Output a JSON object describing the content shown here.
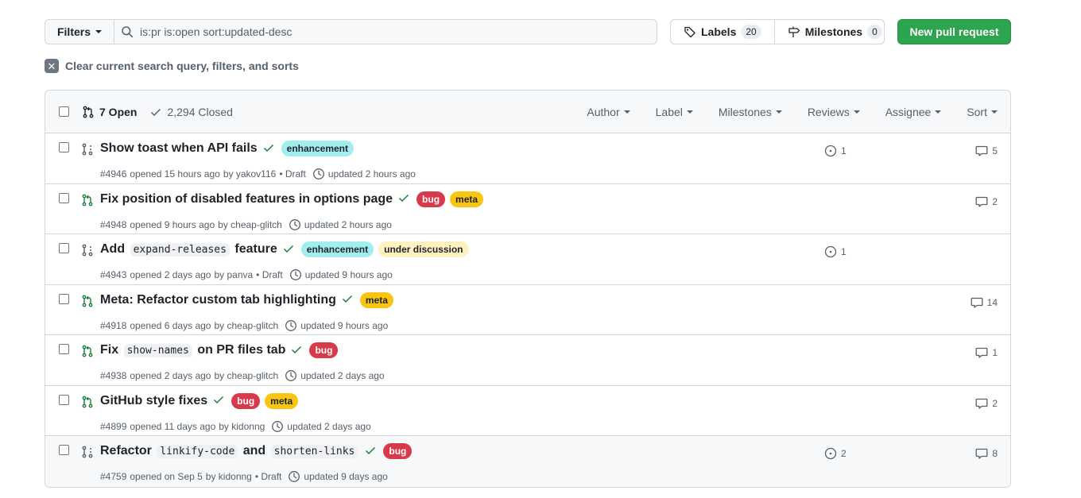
{
  "toolbar": {
    "filters_label": "Filters",
    "search_value": "is:pr is:open sort:updated-desc",
    "labels_label": "Labels",
    "labels_count": "20",
    "milestones_label": "Milestones",
    "milestones_count": "0",
    "new_pr_label": "New pull request"
  },
  "clear_query_label": "Clear current search query, filters, and sorts",
  "header": {
    "open_label": "7 Open",
    "closed_label": "2,294 Closed",
    "filters": [
      "Author",
      "Label",
      "Milestones",
      "Reviews",
      "Assignee",
      "Sort"
    ]
  },
  "colors": {
    "open_green": "#1a7f37",
    "draft_gray": "#57606a",
    "enhancement": "#a2eeef",
    "bug": "#d73a4a",
    "meta": "#f9c513",
    "under_discussion": "#fef2c0"
  },
  "pull_requests": [
    {
      "state": "draft",
      "title_parts": [
        {
          "t": "text",
          "v": "Show toast when API fails"
        }
      ],
      "labels": [
        {
          "name": "enhancement",
          "bg": "#a2eeef",
          "fg": "#1f2328"
        }
      ],
      "number": "#4946",
      "opened": "opened 15 hours ago",
      "author": "by yakov116",
      "draft": "• Draft",
      "updated": "updated 2 hours ago",
      "linked_issues": "1",
      "comments": "5"
    },
    {
      "state": "open",
      "title_parts": [
        {
          "t": "text",
          "v": "Fix position of disabled features in options page"
        }
      ],
      "labels": [
        {
          "name": "bug",
          "bg": "#d73a4a",
          "fg": "#ffffff"
        },
        {
          "name": "meta",
          "bg": "#f9c513",
          "fg": "#1f2328"
        }
      ],
      "number": "#4948",
      "opened": "opened 9 hours ago",
      "author": "by cheap-glitch",
      "draft": "",
      "updated": "updated 2 hours ago",
      "linked_issues": "",
      "comments": "2"
    },
    {
      "state": "draft",
      "title_parts": [
        {
          "t": "text",
          "v": "Add"
        },
        {
          "t": "code",
          "v": "expand-releases"
        },
        {
          "t": "text",
          "v": "feature"
        }
      ],
      "labels": [
        {
          "name": "enhancement",
          "bg": "#a2eeef",
          "fg": "#1f2328"
        },
        {
          "name": "under discussion",
          "bg": "#fef2c0",
          "fg": "#1f2328"
        }
      ],
      "number": "#4943",
      "opened": "opened 2 days ago",
      "author": "by panva",
      "draft": "• Draft",
      "updated": "updated 9 hours ago",
      "linked_issues": "1",
      "comments": ""
    },
    {
      "state": "open",
      "title_parts": [
        {
          "t": "text",
          "v": "Meta: Refactor custom tab highlighting"
        }
      ],
      "labels": [
        {
          "name": "meta",
          "bg": "#f9c513",
          "fg": "#1f2328"
        }
      ],
      "number": "#4918",
      "opened": "opened 6 days ago",
      "author": "by cheap-glitch",
      "draft": "",
      "updated": "updated 9 hours ago",
      "linked_issues": "",
      "comments": "14"
    },
    {
      "state": "open",
      "title_parts": [
        {
          "t": "text",
          "v": "Fix"
        },
        {
          "t": "code",
          "v": "show-names"
        },
        {
          "t": "text",
          "v": "on PR files tab"
        }
      ],
      "labels": [
        {
          "name": "bug",
          "bg": "#d73a4a",
          "fg": "#ffffff"
        }
      ],
      "number": "#4938",
      "opened": "opened 2 days ago",
      "author": "by cheap-glitch",
      "draft": "",
      "updated": "updated 2 days ago",
      "linked_issues": "",
      "comments": "1"
    },
    {
      "state": "open",
      "title_parts": [
        {
          "t": "text",
          "v": "GitHub style fixes"
        }
      ],
      "labels": [
        {
          "name": "bug",
          "bg": "#d73a4a",
          "fg": "#ffffff"
        },
        {
          "name": "meta",
          "bg": "#f9c513",
          "fg": "#1f2328"
        }
      ],
      "number": "#4899",
      "opened": "opened 11 days ago",
      "author": "by kidonng",
      "draft": "",
      "updated": "updated 2 days ago",
      "linked_issues": "",
      "comments": "2"
    },
    {
      "state": "draft",
      "title_parts": [
        {
          "t": "text",
          "v": "Refactor"
        },
        {
          "t": "code",
          "v": "linkify-code"
        },
        {
          "t": "text",
          "v": "and"
        },
        {
          "t": "code",
          "v": "shorten-links"
        }
      ],
      "labels": [
        {
          "name": "bug",
          "bg": "#d73a4a",
          "fg": "#ffffff"
        }
      ],
      "number": "#4759",
      "opened": "opened on Sep 5",
      "author": "by kidonng",
      "draft": "• Draft",
      "updated": "updated 9 days ago",
      "linked_issues": "2",
      "comments": "8"
    }
  ]
}
